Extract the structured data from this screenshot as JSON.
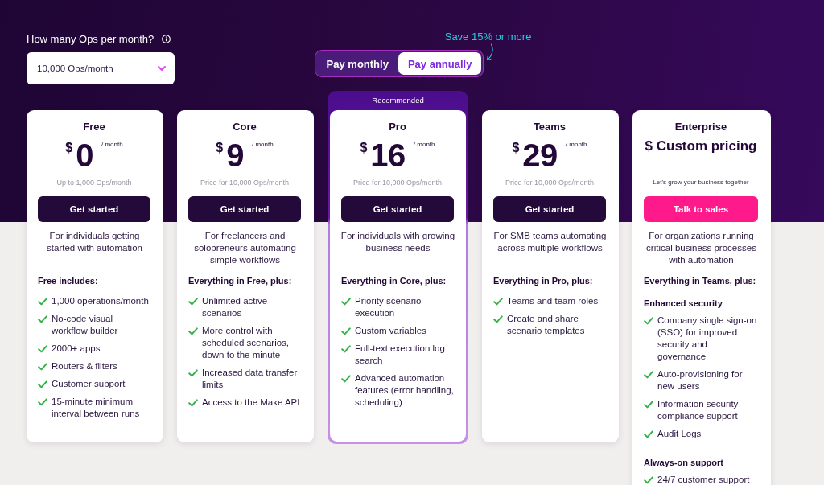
{
  "ops_selector": {
    "label": "How many Ops per month?",
    "value": "10,000 Ops/month"
  },
  "billing_toggle": {
    "note": "Save 15% or more",
    "options": [
      {
        "label": "Pay monthly",
        "selected": false
      },
      {
        "label": "Pay annually",
        "selected": true
      }
    ]
  },
  "plans": [
    {
      "name": "Free",
      "kind": "priced",
      "highlighted": false,
      "currency": "$",
      "price": "0",
      "period": "/ month",
      "subtitle": "Up to 1,000 Ops/month",
      "button": {
        "label": "Get started",
        "kind": "dark"
      },
      "description": "For individuals getting started with automation",
      "features_heading": "Free includes:",
      "feature_groups": [
        {
          "items": [
            "1,000 operations/month",
            "No-code visual workflow builder",
            "2000+ apps",
            "Routers & filters",
            "Customer support",
            "15-minute minimum interval between runs"
          ]
        }
      ]
    },
    {
      "name": "Core",
      "kind": "priced",
      "highlighted": false,
      "currency": "$",
      "price": "9",
      "period": "/ month",
      "subtitle": "Price for 10,000 Ops/month",
      "button": {
        "label": "Get started",
        "kind": "dark"
      },
      "description": "For freelancers and solopreneurs automating simple workflows",
      "features_heading": "Everything in Free, plus:",
      "feature_groups": [
        {
          "items": [
            "Unlimited active scenarios",
            "More control with scheduled scenarios, down to the minute",
            "Increased data transfer limits",
            "Access to the Make API"
          ]
        }
      ]
    },
    {
      "name": "Pro",
      "kind": "priced",
      "highlighted": true,
      "badge": "Recommended",
      "currency": "$",
      "price": "16",
      "period": "/ month",
      "subtitle": "Price for 10,000 Ops/month",
      "button": {
        "label": "Get started",
        "kind": "dark"
      },
      "description": "For individuals with growing business needs",
      "features_heading": "Everything in Core, plus:",
      "feature_groups": [
        {
          "items": [
            "Priority scenario execution",
            "Custom variables",
            "Full-text execution log search",
            "Advanced automation features (error handling, scheduling)"
          ]
        }
      ]
    },
    {
      "name": "Teams",
      "kind": "priced",
      "highlighted": false,
      "currency": "$",
      "price": "29",
      "period": "/ month",
      "subtitle": "Price for 10,000 Ops/month",
      "button": {
        "label": "Get started",
        "kind": "dark"
      },
      "description": "For SMB teams automating across multiple workflows",
      "features_heading": "Everything in Pro, plus:",
      "feature_groups": [
        {
          "items": [
            "Teams and team roles",
            "Create and share scenario templates"
          ]
        }
      ]
    },
    {
      "name": "Enterprise",
      "kind": "custom",
      "highlighted": false,
      "price": "$ Custom pricing",
      "subtitle": "Let's grow your business together",
      "button": {
        "label": "Talk to sales",
        "kind": "accent"
      },
      "description": "For organizations running critical business processes with automation",
      "features_heading": "Everything in Teams, plus:",
      "feature_groups": [
        {
          "title": "Enhanced security",
          "items": [
            "Company single sign-on (SSO) for improved security and governance",
            "Auto-provisioning for new users",
            "Information security compliance support",
            "Audit Logs"
          ]
        },
        {
          "title": "Always-on support",
          "items": [
            "24/7 customer support"
          ]
        }
      ]
    }
  ]
}
